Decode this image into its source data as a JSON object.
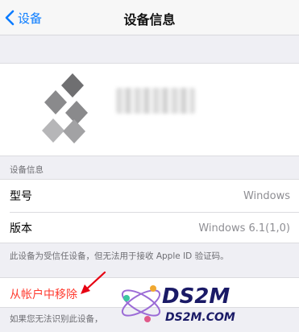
{
  "nav": {
    "back_label": "设备",
    "title": "设备信息"
  },
  "section": {
    "header": "设备信息"
  },
  "info_rows": [
    {
      "label": "型号",
      "value": "Windows"
    },
    {
      "label": "版本",
      "value": "Windows 6.1(1,0)"
    }
  ],
  "footnote": "此设备为受信任设备，但无法用于接收 Apple ID 验证码。",
  "remove": {
    "label": "从帐户中移除"
  },
  "bottom_note": "如果您无法识别此设备，",
  "watermark": {
    "top": "DS2M",
    "bottom": "DS2M.COM"
  },
  "colors": {
    "accent": "#0a7cff",
    "destructive": "#ff3b30",
    "arrow": "#e60012"
  }
}
